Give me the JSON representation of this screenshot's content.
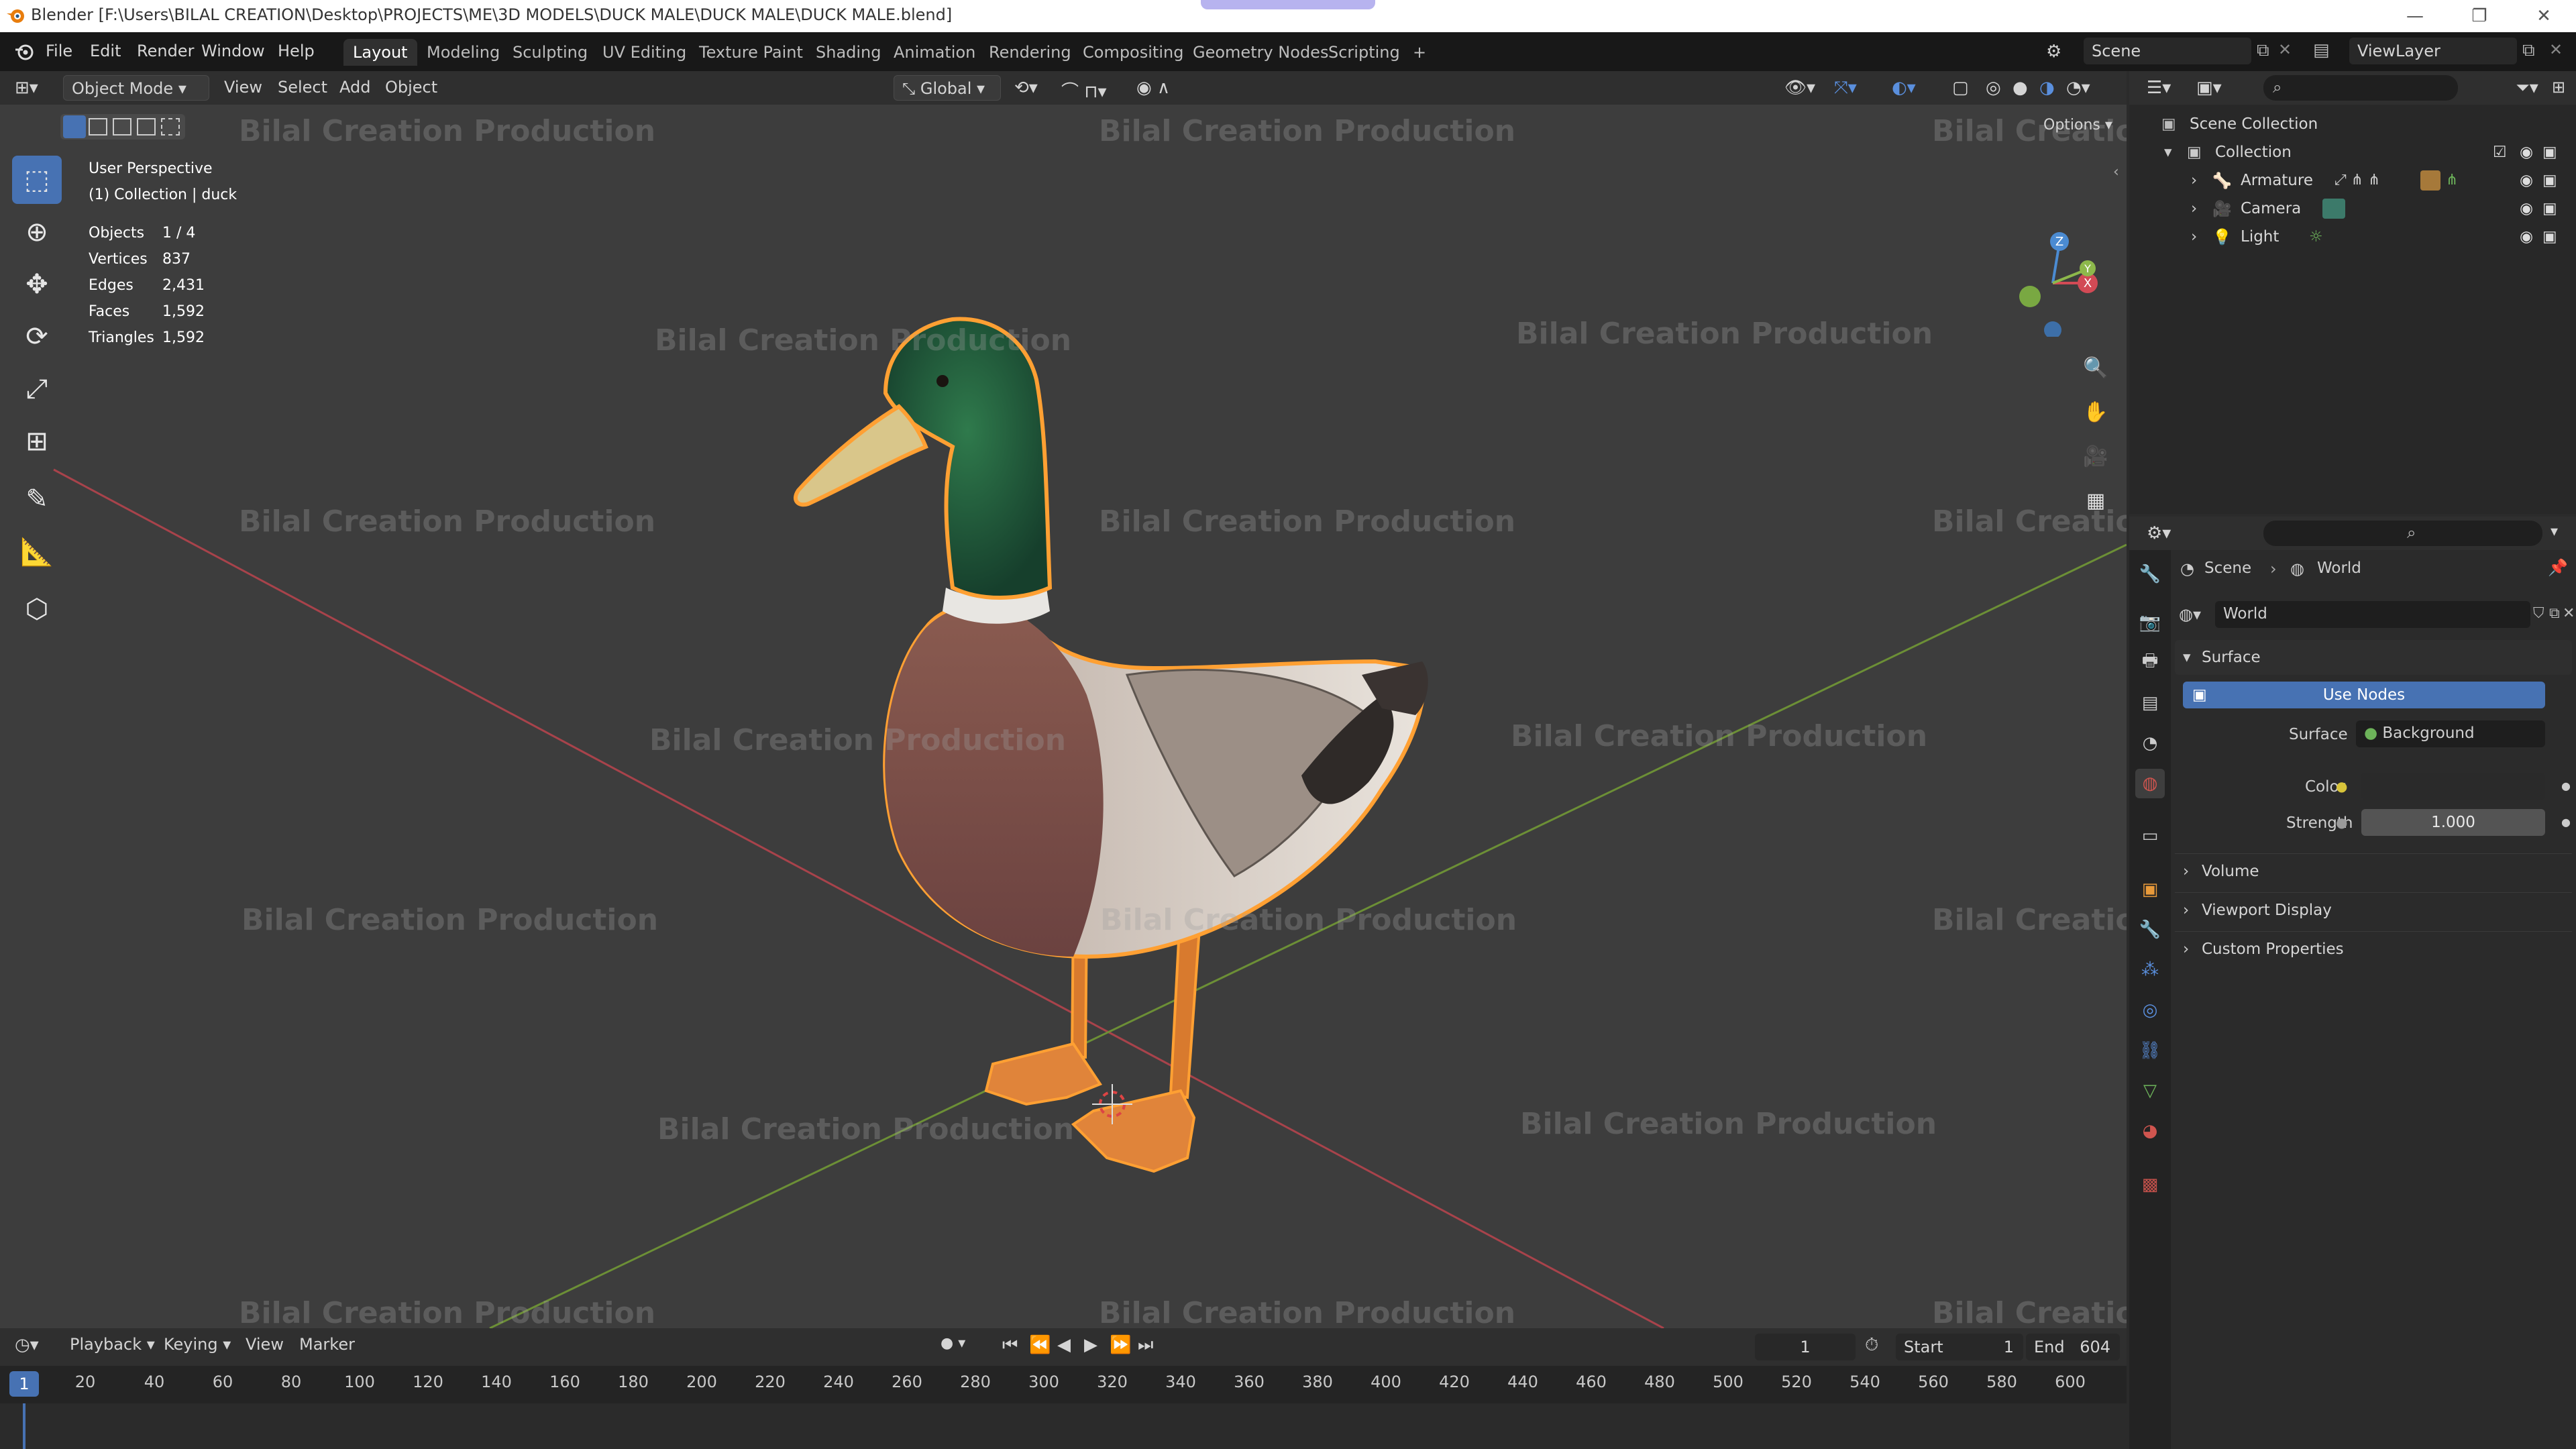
{
  "titlebar": {
    "text": "Blender [F:\\Users\\BILAL CREATION\\Desktop\\PROJECTS\\ME\\3D MODELS\\DUCK MALE\\DUCK MALE\\DUCK MALE.blend]",
    "minimize": "—",
    "maximize": "❐",
    "close": "✕"
  },
  "menu": [
    "File",
    "Edit",
    "Render",
    "Window",
    "Help"
  ],
  "workspaces": [
    "Layout",
    "Modeling",
    "Sculpting",
    "UV Editing",
    "Texture Paint",
    "Shading",
    "Animation",
    "Rendering",
    "Compositing",
    "Geometry Nodes",
    "Scripting",
    "+"
  ],
  "scene": {
    "name": "Scene",
    "view_layer": "ViewLayer"
  },
  "viewport": {
    "mode": "Object Mode",
    "menu": [
      "View",
      "Select",
      "Add",
      "Object"
    ],
    "orientation": "Global",
    "options": "Options"
  },
  "overlay": {
    "perspective": "User Perspective",
    "collection": "(1) Collection | duck",
    "stats": [
      {
        "label": "Objects",
        "value": "1 / 4"
      },
      {
        "label": "Vertices",
        "value": "837"
      },
      {
        "label": "Edges",
        "value": "2,431"
      },
      {
        "label": "Faces",
        "value": "1,592"
      },
      {
        "label": "Triangles",
        "value": "1,592"
      }
    ]
  },
  "watermark": "Bilal Creation Production",
  "timeline": {
    "menu": [
      "Playback",
      "Keying",
      "View",
      "Marker"
    ],
    "current_frame": "1",
    "start_label": "Start",
    "start": "1",
    "end_label": "End",
    "end": "604",
    "ruler": [
      "1",
      "20",
      "40",
      "60",
      "80",
      "100",
      "120",
      "140",
      "160",
      "180",
      "200",
      "220",
      "240",
      "260",
      "280",
      "300",
      "320",
      "340",
      "360",
      "380",
      "400",
      "420",
      "440",
      "460",
      "480",
      "500",
      "520",
      "540",
      "560",
      "580",
      "600"
    ]
  },
  "outliner": {
    "root": "Scene Collection",
    "collection": "Collection",
    "items": [
      "Armature",
      "Camera",
      "Light"
    ]
  },
  "properties": {
    "breadcrumb_scene": "Scene",
    "breadcrumb_world": "World",
    "world_name": "World",
    "surface_section": "Surface",
    "use_nodes": "Use Nodes",
    "surface_label": "Surface",
    "surface_value": "Background",
    "color_label": "Color",
    "strength_label": "Strength",
    "strength_value": "1.000",
    "volume": "Volume",
    "viewport_display": "Viewport Display",
    "custom_properties": "Custom Properties"
  },
  "colors": {
    "accent": "#4772b3",
    "selection_outline": "#ffa033",
    "x_axis": "#d24a55",
    "y_axis": "#8db84b",
    "z_axis": "#4b8bd2"
  }
}
